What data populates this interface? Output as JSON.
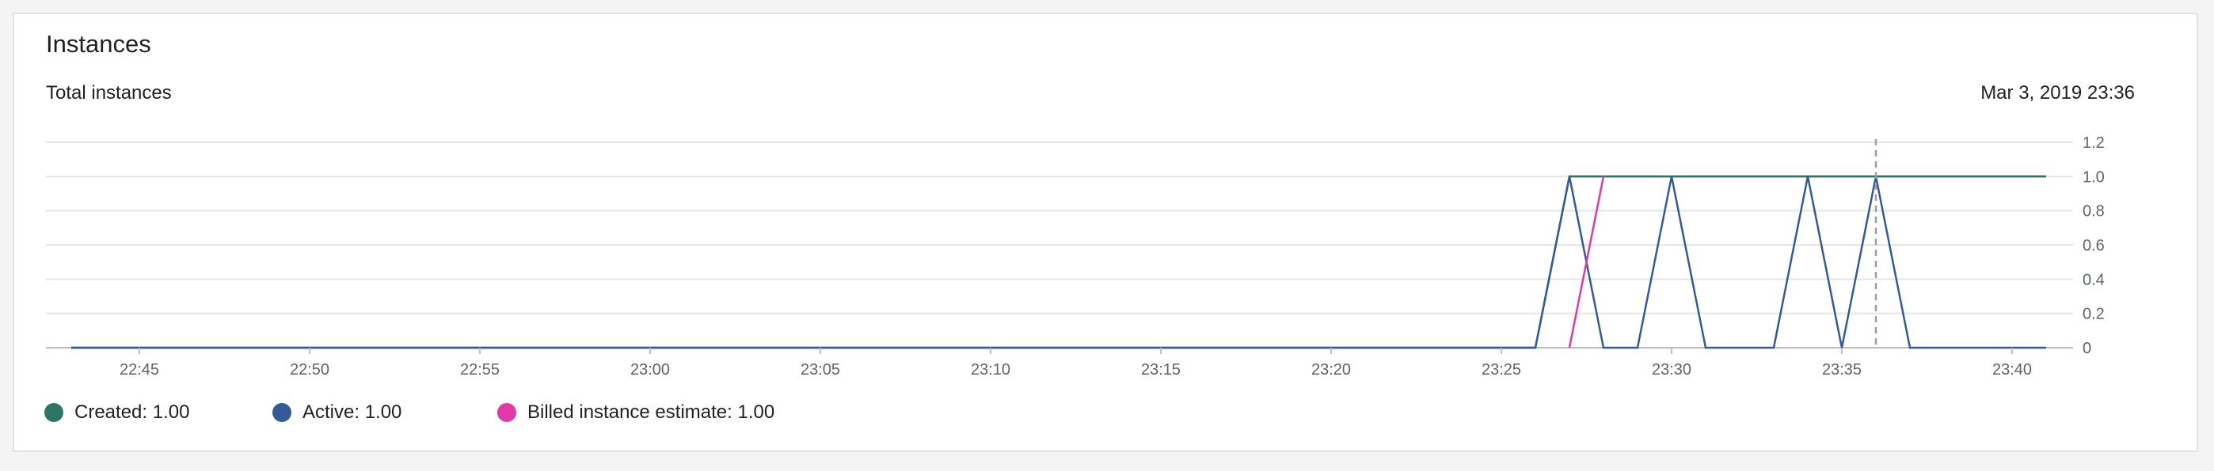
{
  "card": {
    "title": "Instances",
    "subtitle": "Total instances",
    "timestamp": "Mar 3, 2019 23:36"
  },
  "legend": [
    {
      "label": "Created: 1.00",
      "color": "#2e7467"
    },
    {
      "label": "Active: 1.00",
      "color": "#345a9a"
    },
    {
      "label": "Billed instance estimate: 1.00",
      "color": "#e13aa6"
    }
  ],
  "chart_data": {
    "type": "line",
    "title": "Total instances",
    "x_ticks": [
      "22:45",
      "22:50",
      "22:55",
      "23:00",
      "23:05",
      "23:10",
      "23:15",
      "23:20",
      "23:25",
      "23:30",
      "23:35",
      "23:40"
    ],
    "y_ticks": [
      "0",
      "0.2",
      "0.4",
      "0.6",
      "0.8",
      "1.0",
      "1.2"
    ],
    "ylim": [
      0,
      1.2
    ],
    "xlim": [
      "22:43",
      "23:41"
    ],
    "grid": true,
    "cursor_time": "23:36",
    "series": [
      {
        "name": "Created",
        "color": "#2e7467",
        "points": [
          [
            "22:43",
            0
          ],
          [
            "23:26",
            0
          ],
          [
            "23:27",
            1
          ],
          [
            "23:41",
            1
          ]
        ]
      },
      {
        "name": "Active",
        "color": "#345a9a",
        "points": [
          [
            "22:43",
            0
          ],
          [
            "23:26",
            0
          ],
          [
            "23:27",
            1
          ],
          [
            "23:28",
            0
          ],
          [
            "23:29",
            0
          ],
          [
            "23:30",
            1
          ],
          [
            "23:31",
            0
          ],
          [
            "23:33",
            0
          ],
          [
            "23:34",
            1
          ],
          [
            "23:35",
            0
          ],
          [
            "23:36",
            1
          ],
          [
            "23:37",
            0
          ],
          [
            "23:41",
            0
          ]
        ]
      },
      {
        "name": "Billed instance estimate",
        "color": "#e13aa6",
        "points": [
          [
            "23:27",
            0
          ],
          [
            "23:28",
            1
          ]
        ]
      }
    ]
  }
}
